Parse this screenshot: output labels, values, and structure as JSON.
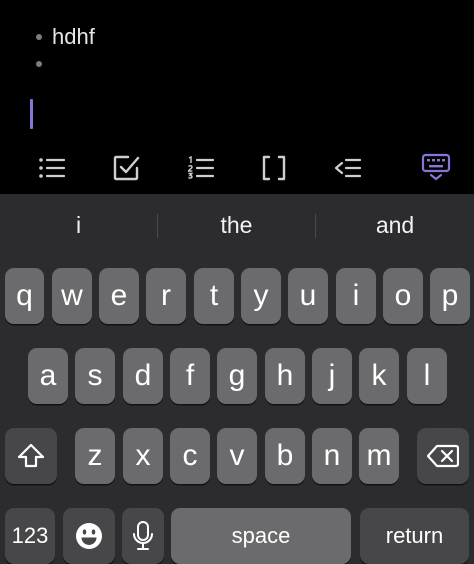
{
  "editor": {
    "items": [
      {
        "text": "hdhf"
      },
      {
        "text": ""
      }
    ]
  },
  "toolbar": {
    "buttons": [
      "bullet-list",
      "checklist",
      "numbered-list",
      "brackets",
      "outdent",
      "keyboard-dismiss"
    ],
    "accent_color": "#8b73d8"
  },
  "keyboard": {
    "suggestions": [
      "i",
      "the",
      "and"
    ],
    "row1": [
      "q",
      "w",
      "e",
      "r",
      "t",
      "y",
      "u",
      "i",
      "o",
      "p"
    ],
    "row2": [
      "a",
      "s",
      "d",
      "f",
      "g",
      "h",
      "j",
      "k",
      "l"
    ],
    "row3": [
      "z",
      "x",
      "c",
      "v",
      "b",
      "n",
      "m"
    ],
    "numbers_label": "123",
    "space_label": "space",
    "return_label": "return"
  }
}
